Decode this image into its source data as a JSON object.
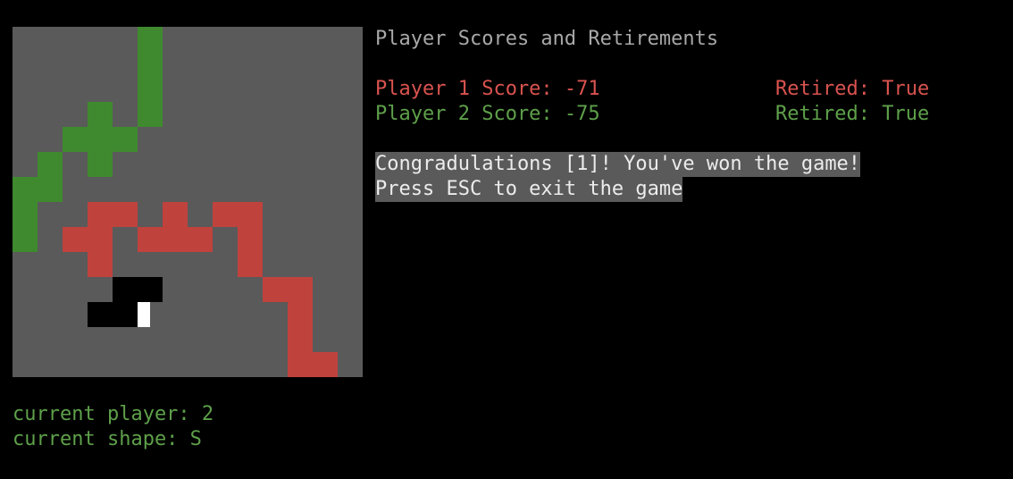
{
  "colors": {
    "background": "#000000",
    "board": "#5a5a5a",
    "player1": "#c0423d",
    "player2": "#3f8a2e",
    "cursor_dark": "#000000",
    "cursor_light": "#ffffff",
    "title": "#a8a8a8",
    "message_text": "#ececec",
    "message_bg": "#5a5a5a",
    "p1_text": "#d9534f",
    "p2_text": "#5ea04a"
  },
  "board": {
    "size": 14,
    "cells": [
      {
        "r": 0,
        "c": 5,
        "o": "p2"
      },
      {
        "r": 1,
        "c": 5,
        "o": "p2"
      },
      {
        "r": 2,
        "c": 5,
        "o": "p2"
      },
      {
        "r": 3,
        "c": 3,
        "o": "p2"
      },
      {
        "r": 3,
        "c": 5,
        "o": "p2"
      },
      {
        "r": 4,
        "c": 2,
        "o": "p2"
      },
      {
        "r": 4,
        "c": 3,
        "o": "p2"
      },
      {
        "r": 4,
        "c": 4,
        "o": "p2"
      },
      {
        "r": 5,
        "c": 1,
        "o": "p2"
      },
      {
        "r": 5,
        "c": 3,
        "o": "p2"
      },
      {
        "r": 6,
        "c": 0,
        "o": "p2"
      },
      {
        "r": 6,
        "c": 1,
        "o": "p2"
      },
      {
        "r": 7,
        "c": 0,
        "o": "p2"
      },
      {
        "r": 7,
        "c": 3,
        "o": "p1"
      },
      {
        "r": 7,
        "c": 4,
        "o": "p1"
      },
      {
        "r": 7,
        "c": 6,
        "o": "p1"
      },
      {
        "r": 7,
        "c": 8,
        "o": "p1"
      },
      {
        "r": 7,
        "c": 9,
        "o": "p1"
      },
      {
        "r": 8,
        "c": 0,
        "o": "p2"
      },
      {
        "r": 8,
        "c": 2,
        "o": "p1"
      },
      {
        "r": 8,
        "c": 3,
        "o": "p1"
      },
      {
        "r": 8,
        "c": 5,
        "o": "p1"
      },
      {
        "r": 8,
        "c": 6,
        "o": "p1"
      },
      {
        "r": 8,
        "c": 7,
        "o": "p1"
      },
      {
        "r": 8,
        "c": 9,
        "o": "p1"
      },
      {
        "r": 9,
        "c": 3,
        "o": "p1"
      },
      {
        "r": 9,
        "c": 9,
        "o": "p1"
      },
      {
        "r": 10,
        "c": 4,
        "o": "cursor_dark"
      },
      {
        "r": 10,
        "c": 5,
        "o": "cursor_dark"
      },
      {
        "r": 10,
        "c": 10,
        "o": "p1"
      },
      {
        "r": 10,
        "c": 11,
        "o": "p1"
      },
      {
        "r": 11,
        "c": 3,
        "o": "cursor_dark"
      },
      {
        "r": 11,
        "c": 4,
        "o": "cursor_dark"
      },
      {
        "r": 11,
        "c": 5,
        "o": "cursor_mixed"
      },
      {
        "r": 11,
        "c": 11,
        "o": "p1"
      },
      {
        "r": 12,
        "c": 11,
        "o": "p1"
      },
      {
        "r": 13,
        "c": 11,
        "o": "p1"
      },
      {
        "r": 13,
        "c": 12,
        "o": "p1"
      }
    ]
  },
  "scores": {
    "title": "Player Scores and Retirements",
    "player1": {
      "score_text": "Player 1 Score: -71",
      "retired_text": "Retired: True"
    },
    "player2": {
      "score_text": "Player 2 Score: -75",
      "retired_text": "Retired: True"
    }
  },
  "message": {
    "line1": "Congradulations [1]! You've won the game!",
    "line2": "Press ESC to exit the game"
  },
  "status": {
    "current_player": "current player: 2",
    "current_shape": "current shape: S"
  }
}
